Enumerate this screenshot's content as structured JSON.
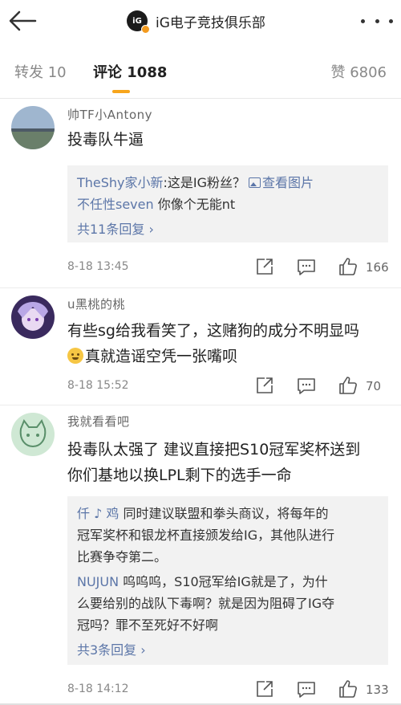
{
  "header": {
    "title": "iG电子竞技俱乐部",
    "logo_text": "iG"
  },
  "tabs": {
    "repost": "转发 10",
    "comment": "评论 1088",
    "like": "赞 6806"
  },
  "comments": [
    {
      "name": "帅TF小Antony",
      "text": "投毒队牛逼",
      "replies": [
        {
          "name": "TheShy家小新",
          "text": ":这是IG粉丝？",
          "link": "查看图片"
        },
        {
          "name": "不任性seven",
          "text": " 你像个无能nt"
        }
      ],
      "more": "共11条回复 ›",
      "time": "8-18 13:45",
      "likes": "166"
    },
    {
      "name": "u黑桃的桃",
      "text_line1": "有些sg给我看笑了，这赌狗的成分不明显吗",
      "text_line2": "真就造谣空凭一张嘴呗",
      "time": "8-18 15:52",
      "likes": "70"
    },
    {
      "name": "我就看看吧",
      "text_line1": "投毒队太强了 建议直接把S10冠军奖杯送到",
      "text_line2": "你们基地以换LPL剩下的选手一命",
      "replies": [
        {
          "name": "仟 ♪ 鸡",
          "text_line1": "  同时建议联盟和拳头商议，将每年的",
          "text_line2": "冠军奖杯和银龙杯直接颁发给IG，其他队进行",
          "text_line3": "比赛争夺第二。"
        },
        {
          "name": "NUJUN",
          "text_line1": " 呜呜呜，S10冠军给IG就是了，为什",
          "text_line2": "么要给别的战队下毒啊？就是因为阻碍了IG夺",
          "text_line3": "冠吗？罪不至死好不好啊"
        }
      ],
      "more": "共3条回复 ›",
      "time": "8-18 14:12",
      "likes": "133"
    }
  ],
  "colors": {
    "accent": "#f7a51c",
    "link": "#5c76a8",
    "reply_bg": "#f2f2f2"
  },
  "icons": {
    "back": "back-arrow-icon",
    "more": "more-dots-icon",
    "share": "share-icon",
    "reply": "comment-icon",
    "like": "thumbs-up-icon",
    "picture": "picture-icon"
  }
}
